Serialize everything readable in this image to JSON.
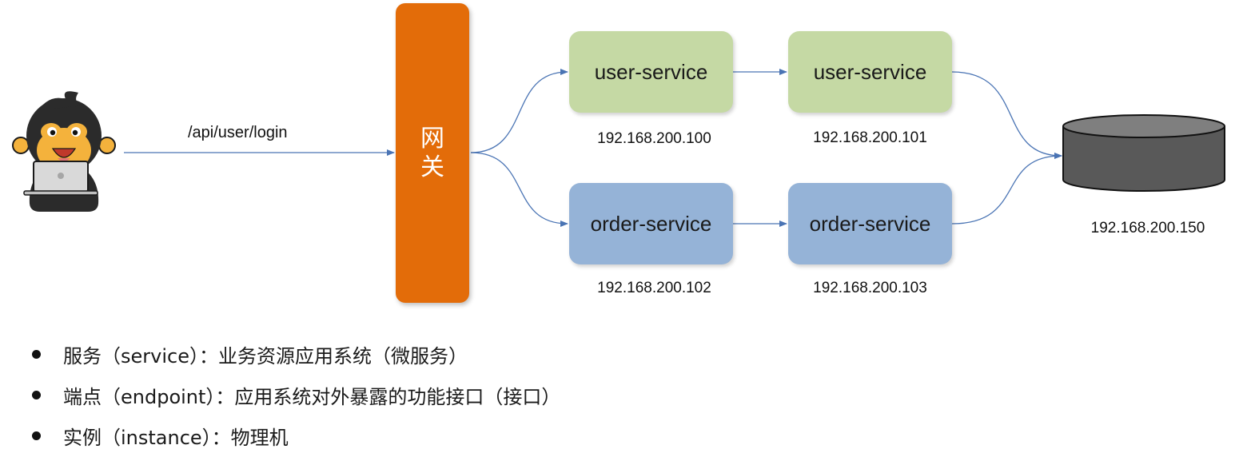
{
  "diagram": {
    "request_path": "/api/user/login",
    "gateway_label": "网关",
    "services": [
      {
        "name": "user-service",
        "ip": "192.168.200.100",
        "color": "#c5d9a4"
      },
      {
        "name": "user-service",
        "ip": "192.168.200.101",
        "color": "#c5d9a4"
      },
      {
        "name": "order-service",
        "ip": "192.168.200.102",
        "color": "#95b3d7"
      },
      {
        "name": "order-service",
        "ip": "192.168.200.103",
        "color": "#95b3d7"
      }
    ],
    "database_ip": "192.168.200.150",
    "colors": {
      "gateway": "#e36c09",
      "arrow": "#4a74b4",
      "database": "#595959"
    }
  },
  "bullets": [
    "服务（service）：业务资源应用系统（微服务）",
    "端点（endpoint）：应用系统对外暴露的功能接口（接口）",
    "实例（instance）：物理机"
  ]
}
